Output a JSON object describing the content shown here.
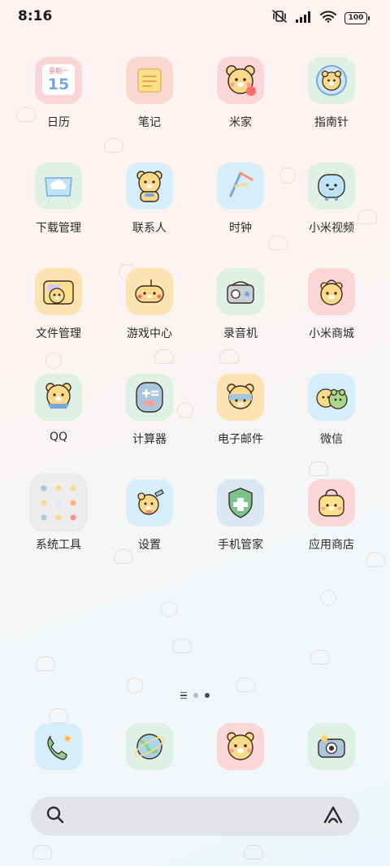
{
  "status_bar": {
    "time": "8:16",
    "battery": "100"
  },
  "apps": [
    {
      "label": "日历",
      "icon": "calendar-icon",
      "calendar_weekday": "星期一",
      "calendar_day": "15"
    },
    {
      "label": "笔记",
      "icon": "notes-icon"
    },
    {
      "label": "米家",
      "icon": "mijia-bear-icon"
    },
    {
      "label": "指南针",
      "icon": "compass-icon"
    },
    {
      "label": "下载管理",
      "icon": "download-cloud-icon"
    },
    {
      "label": "联系人",
      "icon": "contacts-bear-icon"
    },
    {
      "label": "时钟",
      "icon": "clock-icon"
    },
    {
      "label": "小米视频",
      "icon": "video-icon"
    },
    {
      "label": "文件管理",
      "icon": "folder-bear-icon"
    },
    {
      "label": "游戏中心",
      "icon": "game-bear-icon"
    },
    {
      "label": "录音机",
      "icon": "recorder-icon"
    },
    {
      "label": "小米商城",
      "icon": "shop-bear-icon"
    },
    {
      "label": "QQ",
      "icon": "qq-bear-icon"
    },
    {
      "label": "计算器",
      "icon": "calculator-icon"
    },
    {
      "label": "电子邮件",
      "icon": "mail-bear-icon"
    },
    {
      "label": "微信",
      "icon": "wechat-frog-icon"
    },
    {
      "label": "系统工具",
      "icon": "folder-system-tools-icon"
    },
    {
      "label": "设置",
      "icon": "settings-bear-icon"
    },
    {
      "label": "手机管家",
      "icon": "security-shield-icon"
    },
    {
      "label": "应用商店",
      "icon": "app-store-bag-icon"
    }
  ],
  "dock": [
    {
      "icon": "phone-icon"
    },
    {
      "icon": "browser-globe-icon"
    },
    {
      "icon": "messages-bear-icon"
    },
    {
      "icon": "camera-icon"
    }
  ],
  "search": {
    "icon": "search-icon",
    "assistant_icon": "ai-assistant-icon"
  },
  "colors": {
    "bear_face": "#fbd98a",
    "bear_outline": "#3a2a22",
    "cheek": "#ff8f8f",
    "text": "#2b2b2b"
  }
}
